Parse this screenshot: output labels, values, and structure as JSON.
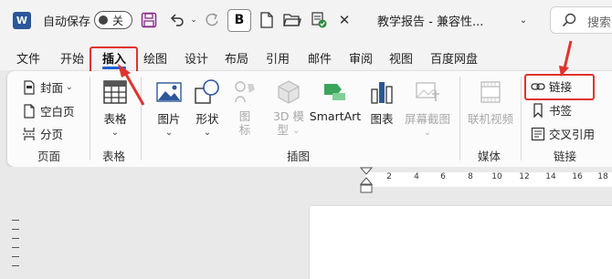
{
  "titlebar": {
    "app_logo": "W",
    "autosave_label": "自动保存",
    "autosave_state": "关",
    "bold_label": "B",
    "doc_title": "教学报告 - 兼容性...",
    "search_placeholder": "搜索"
  },
  "tabs": [
    "文件",
    "开始",
    "插入",
    "绘图",
    "设计",
    "布局",
    "引用",
    "邮件",
    "审阅",
    "视图",
    "百度网盘"
  ],
  "active_tab": "插入",
  "ribbon": {
    "pages": {
      "label": "页面",
      "cover": "封面",
      "blank": "空白页",
      "break": "分页"
    },
    "tables": {
      "label": "表格",
      "table": "表格"
    },
    "illustrations": {
      "label": "插图",
      "picture": "图片",
      "shapes": "形状",
      "icons_top": "图",
      "icons_bottom": "标",
      "model_top": "3D 模",
      "model_bottom": "型",
      "smartart": "SmartArt",
      "chart": "图表",
      "screenshot": "屏幕截图"
    },
    "media": {
      "label": "媒体",
      "video": "联机视频"
    },
    "links": {
      "label": "链接",
      "link": "链接",
      "bookmark": "书签",
      "crossref": "交叉引用"
    }
  },
  "ruler_ticks": [
    "2",
    "4",
    "6",
    "8",
    "10",
    "12",
    "14",
    "16",
    "18"
  ],
  "colors": {
    "accent": "#1f5fd4",
    "highlight": "#e0332e",
    "word_blue": "#2b579a",
    "smartart_green": "#3ba55c"
  }
}
